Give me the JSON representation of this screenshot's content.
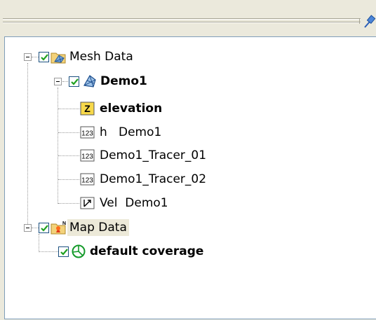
{
  "tree": {
    "mesh_data": {
      "label": "Mesh Data",
      "expanded": true,
      "checked": true,
      "icon": "mesh-folder-icon"
    },
    "demo1": {
      "label": "Demo1",
      "expanded": true,
      "checked": true,
      "icon": "mesh-icon"
    },
    "elevation": {
      "label": "elevation",
      "icon": "z-dataset-icon",
      "icon_text": "Z"
    },
    "h_demo1": {
      "label": "h   Demo1",
      "icon": "scalar-dataset-icon",
      "icon_text": "123"
    },
    "tracer_01": {
      "label": "Demo1_Tracer_01",
      "icon": "scalar-dataset-icon",
      "icon_text": "123"
    },
    "tracer_02": {
      "label": "Demo1_Tracer_02",
      "icon": "scalar-dataset-icon",
      "icon_text": "123"
    },
    "vel_demo1": {
      "label": "Vel  Demo1",
      "icon": "vector-dataset-icon"
    },
    "map_data": {
      "label": "Map Data",
      "expanded": true,
      "checked": true,
      "icon": "map-folder-icon"
    },
    "default_coverage": {
      "label": "default coverage",
      "checked": true,
      "icon": "coverage-icon"
    }
  },
  "colors": {
    "panel_border": "#7f9db9",
    "check_border": "#1c5180",
    "check_mark": "#21a121",
    "z_icon_bg": "#f8d94a"
  }
}
